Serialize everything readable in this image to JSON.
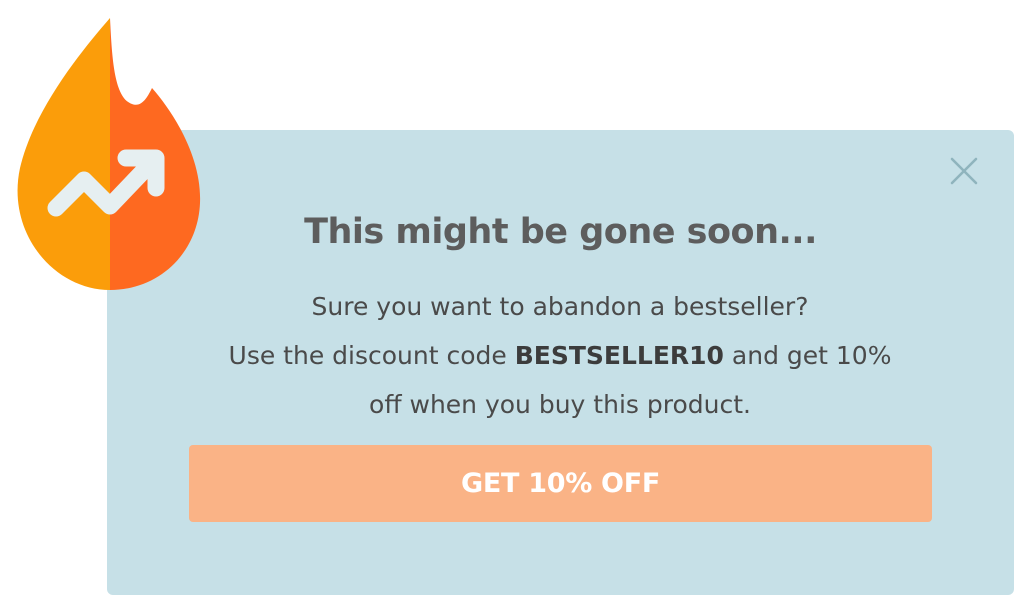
{
  "popup": {
    "title": "This might be gone soon...",
    "line1": "Sure you want to abandon a bestseller?",
    "line2_prefix": "Use the discount code ",
    "discount_code": "BESTSELLER10",
    "line2_suffix": " and get 10%",
    "line3": "off when you buy this product.",
    "cta_label": "GET 10% OFF"
  },
  "icons": {
    "badge": "flame-trending-icon",
    "close": "close-icon"
  },
  "colors": {
    "background": "#c6e0e7",
    "button": "#fab386",
    "flame_left": "#fb9d0a",
    "flame_right": "#fe6920",
    "title": "#5d5d5d"
  }
}
